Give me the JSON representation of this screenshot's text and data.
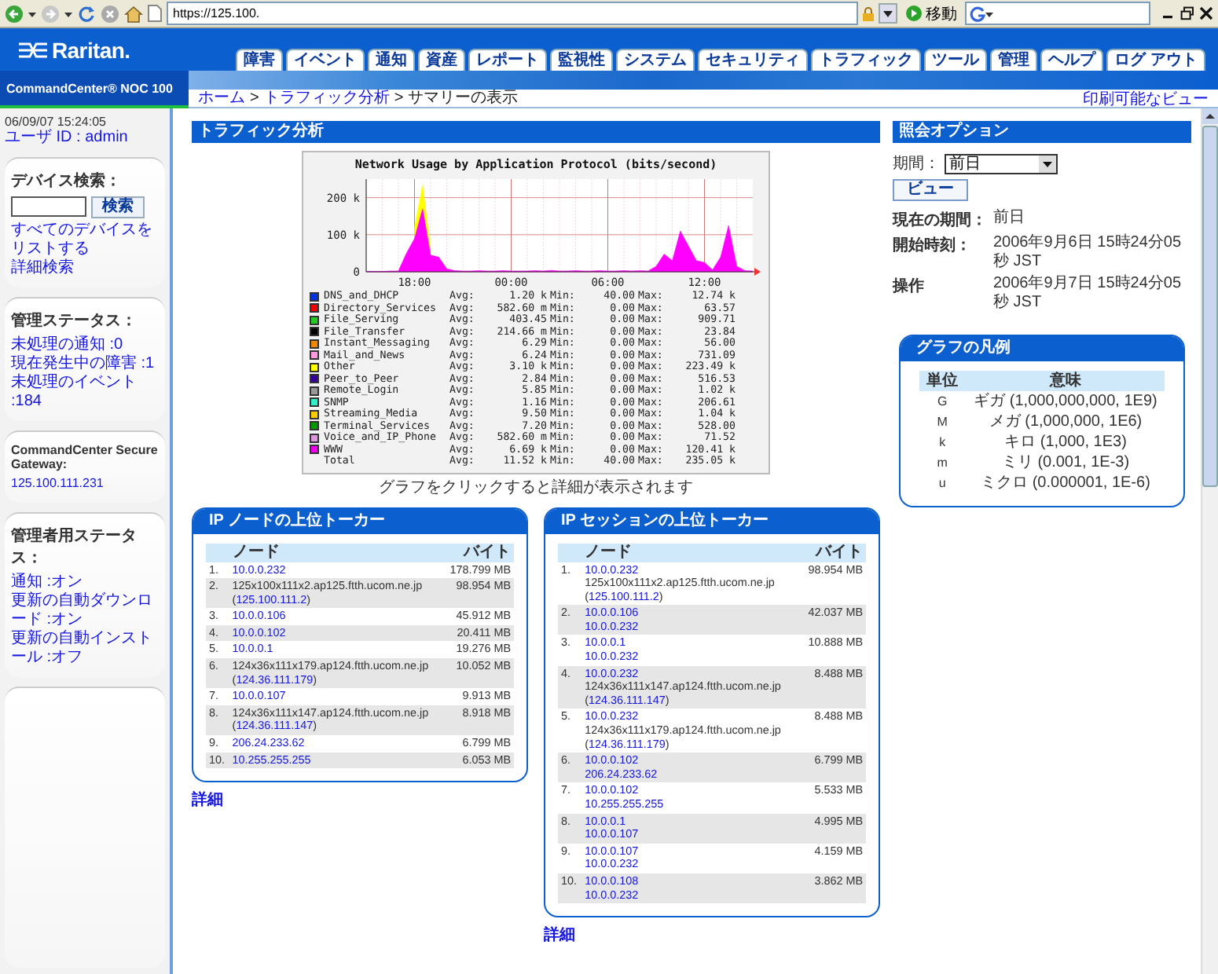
{
  "browser": {
    "address": "https://125.100.",
    "go_label": "移動"
  },
  "header": {
    "logo": "Raritan.",
    "product": "CommandCenter® NOC 100",
    "tabs": [
      "障害",
      "イベント",
      "通知",
      "資産",
      "レポート",
      "監視性",
      "システム",
      "セキュリティ",
      "トラフィック",
      "ツール",
      "管理",
      "ヘルプ",
      "ログ アウト"
    ],
    "breadcrumb": [
      {
        "text": "ホーム",
        "link": true
      },
      {
        "text": "トラフィック分析",
        "link": true
      },
      {
        "text": "サマリーの表示",
        "link": false
      }
    ],
    "separator": ">",
    "print_link": "印刷可能なビュー"
  },
  "sidebar": {
    "timestamp": "06/09/07 15:24:05",
    "user": "ユーザ ID : admin",
    "device_search": {
      "title": "デバイス検索：",
      "button": "検索",
      "links": [
        "すべてのデバイスをリストする",
        "詳細検索"
      ]
    },
    "admin_status": {
      "title": "管理ステータス：",
      "links": [
        "未処理の通知 :0",
        "現在発生中の障害 :1",
        "未処理のイベント :184"
      ]
    },
    "gateway": {
      "title": "CommandCenter Secure Gateway:",
      "link": "125.100.111.231"
    },
    "admin_user_status": {
      "title": "管理者用ステータス：",
      "links": [
        "通知 :オン",
        "更新の自動ダウンロード :オン",
        "更新の自動インストール :オフ"
      ]
    }
  },
  "traffic": {
    "title": "トラフィック分析",
    "chart_data": {
      "type": "area",
      "title": "Network Usage by Application Protocol (bits/second)",
      "categories": [
        null,
        null,
        null,
        null,
        null,
        null,
        "18:00",
        null,
        null,
        null,
        null,
        null,
        null,
        null,
        null,
        null,
        null,
        null,
        "00:00",
        null,
        null,
        null,
        null,
        null,
        null,
        null,
        null,
        null,
        null,
        null,
        "06:00",
        null,
        null,
        null,
        null,
        null,
        null,
        null,
        null,
        null,
        null,
        null,
        "12:00",
        null,
        null,
        null,
        null,
        null,
        null
      ],
      "series": [
        {
          "color": "#ffff00",
          "values": [
            null,
            null,
            null,
            null,
            null,
            null,
            120000,
            235000,
            60000,
            null,
            null,
            null,
            null,
            null,
            null,
            null,
            null,
            null,
            null,
            null,
            null,
            null,
            null,
            null,
            null,
            null,
            null,
            null,
            null,
            null,
            null,
            null,
            null,
            null,
            null,
            null,
            null,
            null,
            null,
            null,
            null,
            null,
            null,
            null,
            null,
            null,
            null,
            null,
            null
          ]
        },
        {
          "color": "#ff00ff",
          "values": [
            1000,
            1000,
            1000,
            2000,
            2000,
            50000,
            90000,
            170000,
            45000,
            40000,
            8000,
            3000,
            2000,
            2000,
            3000,
            2000,
            2000,
            3000,
            2000,
            2000,
            2000,
            3000,
            2000,
            4000,
            2000,
            2000,
            3000,
            2000,
            2000,
            3000,
            2000,
            2000,
            3000,
            2000,
            3000,
            2000,
            15000,
            48000,
            30000,
            110000,
            70000,
            30000,
            25000,
            5000,
            40000,
            125000,
            15000,
            3000,
            2000
          ]
        }
      ],
      "ylim": [
        0,
        250000
      ],
      "grid": true,
      "yticks": [
        {
          "value": 0,
          "label": "0"
        },
        {
          "value": 100000,
          "label": "100 k"
        },
        {
          "value": 200000,
          "label": "200 k"
        }
      ]
    },
    "legend": [
      {
        "color": "#0033dd",
        "name": "DNS_and_DHCP",
        "avg_label": "Avg:",
        "avg": "1.20 k",
        "min_label": "Min:",
        "min": "40.00",
        "max_label": "Max:",
        "max": "12.74 k"
      },
      {
        "color": "#ee0000",
        "name": "Directory_Services",
        "avg_label": "Avg:",
        "avg": "582.60 m",
        "min_label": "Min:",
        "min": "0.00",
        "max_label": "Max:",
        "max": "63.57"
      },
      {
        "color": "#22cc22",
        "name": "File_Serving",
        "avg_label": "Avg:",
        "avg": "403.45",
        "min_label": "Min:",
        "min": "0.00",
        "max_label": "Max:",
        "max": "909.71"
      },
      {
        "color": "#000000",
        "name": "File_Transfer",
        "avg_label": "Avg:",
        "avg": "214.66 m",
        "min_label": "Min:",
        "min": "0.00",
        "max_label": "Max:",
        "max": "23.84"
      },
      {
        "color": "#ee8800",
        "name": "Instant_Messaging",
        "avg_label": "Avg:",
        "avg": "6.29",
        "min_label": "Min:",
        "min": "0.00",
        "max_label": "Max:",
        "max": "56.00"
      },
      {
        "color": "#ff99dd",
        "name": "Mail_and_News",
        "avg_label": "Avg:",
        "avg": "6.24",
        "min_label": "Min:",
        "min": "0.00",
        "max_label": "Max:",
        "max": "731.09"
      },
      {
        "color": "#ffff00",
        "name": "Other",
        "avg_label": "Avg:",
        "avg": "3.10 k",
        "min_label": "Min:",
        "min": "0.00",
        "max_label": "Max:",
        "max": "223.49 k"
      },
      {
        "color": "#330099",
        "name": "Peer_to_Peer",
        "avg_label": "Avg:",
        "avg": "2.84",
        "min_label": "Min:",
        "min": "0.00",
        "max_label": "Max:",
        "max": "516.53"
      },
      {
        "color": "#999999",
        "name": "Remote_Login",
        "avg_label": "Avg:",
        "avg": "5.85",
        "min_label": "Min:",
        "min": "0.00",
        "max_label": "Max:",
        "max": "1.02 k"
      },
      {
        "color": "#33eecc",
        "name": "SNMP",
        "avg_label": "Avg:",
        "avg": "1.16",
        "min_label": "Min:",
        "min": "0.00",
        "max_label": "Max:",
        "max": "206.61"
      },
      {
        "color": "#ffcc00",
        "name": "Streaming_Media",
        "avg_label": "Avg:",
        "avg": "9.50",
        "min_label": "Min:",
        "min": "0.00",
        "max_label": "Max:",
        "max": "1.04 k"
      },
      {
        "color": "#009900",
        "name": "Terminal_Services",
        "avg_label": "Avg:",
        "avg": "7.20",
        "min_label": "Min:",
        "min": "0.00",
        "max_label": "Max:",
        "max": "528.00"
      },
      {
        "color": "#dd99dd",
        "name": "Voice_and_IP_Phone",
        "avg_label": "Avg:",
        "avg": "582.60 m",
        "min_label": "Min:",
        "min": "0.00",
        "max_label": "Max:",
        "max": "71.52"
      },
      {
        "color": "#ee00ee",
        "name": "WWW",
        "avg_label": "Avg:",
        "avg": "6.69 k",
        "min_label": "Min:",
        "min": "0.00",
        "max_label": "Max:",
        "max": "120.41 k"
      },
      {
        "name": "Total",
        "avg_label": "Avg:",
        "avg": "11.52 k",
        "min_label": "Min:",
        "min": "40.00",
        "max_label": "Max:",
        "max": "235.05 k"
      }
    ],
    "caption": "グラフをクリックすると詳細が表示されます"
  },
  "top_nodes": {
    "title": "IP ノードの上位トーカー",
    "columns": [
      "ノード",
      "バイト"
    ],
    "more_link": "詳細",
    "rows": [
      {
        "rank": "1.",
        "lines": [
          {
            "kind": "link",
            "text": "10.0.0.232"
          }
        ],
        "bytes": "178.799 MB"
      },
      {
        "rank": "2.",
        "lines": [
          {
            "kind": "text",
            "text": "125x100x111x2.ap125.ftth.ucom.ne.jp"
          },
          {
            "kind": "paren_link",
            "open": "(",
            "text": "125.100.111.2",
            "close": ")"
          }
        ],
        "bytes": "98.954 MB"
      },
      {
        "rank": "3.",
        "lines": [
          {
            "kind": "link",
            "text": "10.0.0.106"
          }
        ],
        "bytes": "45.912 MB"
      },
      {
        "rank": "4.",
        "lines": [
          {
            "kind": "link",
            "text": "10.0.0.102"
          }
        ],
        "bytes": "20.411 MB"
      },
      {
        "rank": "5.",
        "lines": [
          {
            "kind": "link",
            "text": "10.0.0.1"
          }
        ],
        "bytes": "19.276 MB"
      },
      {
        "rank": "6.",
        "lines": [
          {
            "kind": "text",
            "text": "124x36x111x179.ap124.ftth.ucom.ne.jp"
          },
          {
            "kind": "paren_link",
            "open": "(",
            "text": "124.36.111.179",
            "close": ")"
          }
        ],
        "bytes": "10.052 MB"
      },
      {
        "rank": "7.",
        "lines": [
          {
            "kind": "link",
            "text": "10.0.0.107"
          }
        ],
        "bytes": "9.913 MB"
      },
      {
        "rank": "8.",
        "lines": [
          {
            "kind": "text",
            "text": "124x36x111x147.ap124.ftth.ucom.ne.jp"
          },
          {
            "kind": "paren_link",
            "open": "(",
            "text": "124.36.111.147",
            "close": ")"
          }
        ],
        "bytes": "8.918 MB"
      },
      {
        "rank": "9.",
        "lines": [
          {
            "kind": "link",
            "text": "206.24.233.62"
          }
        ],
        "bytes": "6.799 MB"
      },
      {
        "rank": "10.",
        "lines": [
          {
            "kind": "link",
            "text": "10.255.255.255"
          }
        ],
        "bytes": "6.053 MB"
      }
    ]
  },
  "top_sessions": {
    "title": "IP セッションの上位トーカー",
    "columns": [
      "ノード",
      "バイト"
    ],
    "more_link": "詳細",
    "rows": [
      {
        "rank": "1.",
        "lines": [
          {
            "kind": "link",
            "text": "10.0.0.232"
          },
          {
            "kind": "text",
            "text": "125x100x111x2.ap125.ftth.ucom.ne.jp"
          },
          {
            "kind": "paren_link",
            "open": "(",
            "text": "125.100.111.2",
            "close": ")"
          }
        ],
        "bytes": "98.954 MB"
      },
      {
        "rank": "2.",
        "lines": [
          {
            "kind": "link",
            "text": "10.0.0.106"
          },
          {
            "kind": "link",
            "text": "10.0.0.232"
          }
        ],
        "bytes": "42.037 MB"
      },
      {
        "rank": "3.",
        "lines": [
          {
            "kind": "link",
            "text": "10.0.0.1"
          },
          {
            "kind": "link",
            "text": "10.0.0.232"
          }
        ],
        "bytes": "10.888 MB"
      },
      {
        "rank": "4.",
        "lines": [
          {
            "kind": "link",
            "text": "10.0.0.232"
          },
          {
            "kind": "text",
            "text": "124x36x111x147.ap124.ftth.ucom.ne.jp"
          },
          {
            "kind": "paren_link",
            "open": "(",
            "text": "124.36.111.147",
            "close": ")"
          }
        ],
        "bytes": "8.488 MB"
      },
      {
        "rank": "5.",
        "lines": [
          {
            "kind": "link",
            "text": "10.0.0.232"
          },
          {
            "kind": "text",
            "text": "124x36x111x179.ap124.ftth.ucom.ne.jp"
          },
          {
            "kind": "paren_link",
            "open": "(",
            "text": "124.36.111.179",
            "close": ")"
          }
        ],
        "bytes": "8.488 MB"
      },
      {
        "rank": "6.",
        "lines": [
          {
            "kind": "link",
            "text": "10.0.0.102"
          },
          {
            "kind": "link",
            "text": "206.24.233.62"
          }
        ],
        "bytes": "6.799 MB"
      },
      {
        "rank": "7.",
        "lines": [
          {
            "kind": "link",
            "text": "10.0.0.102"
          },
          {
            "kind": "link",
            "text": "10.255.255.255"
          }
        ],
        "bytes": "5.533 MB"
      },
      {
        "rank": "8.",
        "lines": [
          {
            "kind": "link",
            "text": "10.0.0.1"
          },
          {
            "kind": "link",
            "text": "10.0.0.107"
          }
        ],
        "bytes": "4.995 MB"
      },
      {
        "rank": "9.",
        "lines": [
          {
            "kind": "link",
            "text": "10.0.0.107"
          },
          {
            "kind": "link",
            "text": "10.0.0.232"
          }
        ],
        "bytes": "4.159 MB"
      },
      {
        "rank": "10.",
        "lines": [
          {
            "kind": "link",
            "text": "10.0.0.108"
          },
          {
            "kind": "link",
            "text": "10.0.0.232"
          }
        ],
        "bytes": "3.862 MB"
      }
    ]
  },
  "query_options": {
    "title": "照会オプション",
    "period_label": "期間：",
    "period_value": "前日",
    "view_button": "ビュー",
    "info": [
      {
        "label": "現在の期間：",
        "value": "前日"
      },
      {
        "label": "開始時刻：",
        "value": "2006年9月6日 15時24分05秒 JST"
      },
      {
        "label": "操作",
        "value": "2006年9月7日 15時24分05秒 JST"
      }
    ]
  },
  "graph_legend": {
    "title": "グラフの凡例",
    "columns": [
      "単位",
      "意味"
    ],
    "rows": [
      {
        "unit": "G",
        "meaning": "ギガ (1,000,000,000, 1E9)"
      },
      {
        "unit": "M",
        "meaning": "メガ (1,000,000, 1E6)"
      },
      {
        "unit": "k",
        "meaning": "キロ (1,000, 1E3)"
      },
      {
        "unit": "m",
        "meaning": "ミリ (0.001, 1E-3)"
      },
      {
        "unit": "u",
        "meaning": "ミクロ (0.000001, 1E-6)"
      }
    ]
  }
}
